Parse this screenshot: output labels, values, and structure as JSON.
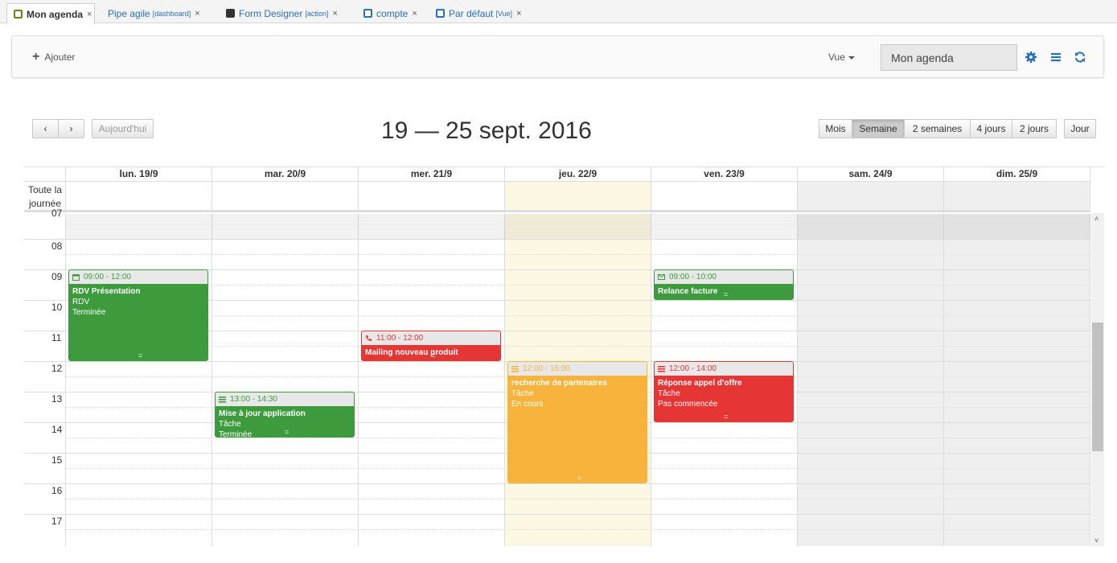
{
  "tabs": [
    {
      "label": "Mon agenda",
      "sub": "",
      "color": "#5a8a1a"
    },
    {
      "label": "Pipe agile",
      "sub": "[dashboard]",
      "color": ""
    },
    {
      "label": "Form Designer",
      "sub": "[action]",
      "color": "#333"
    },
    {
      "label": "compte",
      "sub": "",
      "color": "#2a6fb8"
    },
    {
      "label": "Par défaut",
      "sub": "[Vue]",
      "color": "#2a6fb8"
    }
  ],
  "toolbar": {
    "add_label": "Ajouter",
    "view_label": "Vue",
    "agenda_value": "Mon agenda"
  },
  "nav": {
    "today": "Aujourd'hui",
    "prev": "‹",
    "next": "›"
  },
  "title": "19 — 25 sept. 2016",
  "views": [
    "Mois",
    "Semaine",
    "2 semaines",
    "4 jours",
    "2 jours",
    "Jour"
  ],
  "allday_label": "Toute la journée",
  "days": [
    "lun. 19/9",
    "mar. 20/9",
    "mer. 21/9",
    "jeu. 22/9",
    "ven. 23/9",
    "sam. 24/9",
    "dim. 25/9"
  ],
  "hours": [
    "07",
    "08",
    "09",
    "10",
    "11",
    "12",
    "13",
    "14",
    "15",
    "16",
    "17"
  ],
  "events": [
    {
      "day": 0,
      "start": 9,
      "end": 12,
      "time": "09:00 - 12:00",
      "title": "RDV Présentation",
      "line2": "RDV",
      "line3": "Terminée",
      "color": "#3d9b3d",
      "icon": "calendar-icon"
    },
    {
      "day": 1,
      "start": 13,
      "end": 14.5,
      "time": "13:00 - 14:30",
      "title": "Mise à jour application",
      "line2": "Tâche",
      "line3": "Terminée",
      "color": "#3d9b3d",
      "icon": "list-icon"
    },
    {
      "day": 2,
      "start": 11,
      "end": 12,
      "time": "11:00 - 12:00",
      "title": "Mailing nouveau produit",
      "line2": "",
      "line3": "",
      "color": "#e53535",
      "icon": "phone-icon"
    },
    {
      "day": 3,
      "start": 12,
      "end": 16,
      "time": "12:00 - 16:00",
      "title": "recherche de partenaires",
      "line2": "Tâche",
      "line3": "En cours",
      "color": "#f7b33b",
      "icon": "list-icon"
    },
    {
      "day": 4,
      "start": 9,
      "end": 10,
      "time": "09:00 - 10:00",
      "title": "Relance facture",
      "line2": "",
      "line3": "",
      "color": "#3d9b3d",
      "icon": "mail-icon"
    },
    {
      "day": 4,
      "start": 12,
      "end": 14,
      "time": "12:00 - 14:00",
      "title": "Réponse appel d'offre",
      "line2": "Tâche",
      "line3": "Pas commencée",
      "color": "#e53535",
      "icon": "list-icon"
    }
  ],
  "colors": {
    "today_bg": "#fcf8e3",
    "weekend_bg": "#efefef"
  }
}
